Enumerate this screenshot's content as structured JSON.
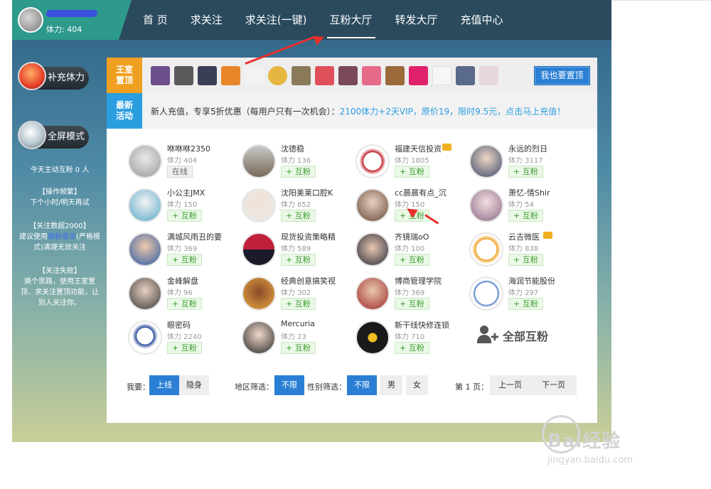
{
  "profile": {
    "stamina_text": "体力: 404"
  },
  "nav": {
    "items": [
      "首 页",
      "求关注",
      "求关注(一键)",
      "互粉大厅",
      "转发大厅",
      "充值中心"
    ],
    "active": "互粉大厅"
  },
  "sidebar": {
    "refill_label": "补充体力",
    "fullscreen_label": "全屏模式",
    "today_text": "今天主动互粉 0 人",
    "ops_title": "【操作频繁】",
    "ops_text": "下个小时/明天再试",
    "follow_title": "【关注数超2000】",
    "follow_text_1": "建议使用",
    "follow_link": "猫粉查杀",
    "follow_text_2": "(严格模式)清理无效关注",
    "fail_title": "【关注失败】",
    "fail_text": "换个思路，使用王室置顶、求关注置顶功能，让别人关注你。"
  },
  "king_row": {
    "tag_1": "王室",
    "tag_2": "置顶",
    "pin_button": "我也要置顶"
  },
  "activity_row": {
    "tag_1": "最新",
    "tag_2": "活动",
    "text": "新人充值，专享5折优惠（每用户只有一次机会）：",
    "link": "2100体力+2天VIP，原价19，限时9.5元，点击马上充值！"
  },
  "users": [
    {
      "name": "咻咻咻2350",
      "stamina": "体力 404",
      "button": "在线"
    },
    {
      "name": "沈德稳",
      "stamina": "体力 136",
      "button": "+ 互粉"
    },
    {
      "name": "福建天信投资",
      "stamina": "体力 1805",
      "button": "+ 互粉"
    },
    {
      "name": "永远的烈日",
      "stamina": "体力 3117",
      "button": "+ 互粉"
    },
    {
      "name": "小公主JMX",
      "stamina": "体力 150",
      "button": "+ 互粉"
    },
    {
      "name": "沈阳美莱口腔K",
      "stamina": "体力 652",
      "button": "+ 互粉"
    },
    {
      "name": "cc晨晨有点_沉",
      "stamina": "体力 150",
      "button": "+ 互粉"
    },
    {
      "name": "萧忆-情Shir",
      "stamina": "体力 54",
      "button": "+ 互粉"
    },
    {
      "name": "满城风雨丑的要",
      "stamina": "体力 369",
      "button": "+ 互粉"
    },
    {
      "name": "现货投资策略精",
      "stamina": "体力 589",
      "button": "+ 互粉"
    },
    {
      "name": "齐镜瑞oO",
      "stamina": "体力 100",
      "button": "+ 互粉"
    },
    {
      "name": "云吉微医",
      "stamina": "体力 838",
      "button": "+ 互粉"
    },
    {
      "name": "金峰解盘",
      "stamina": "体力 96",
      "button": "+ 互粉"
    },
    {
      "name": "经典创意搞笑视",
      "stamina": "体力 302",
      "button": "+ 互粉"
    },
    {
      "name": "博商管理学院",
      "stamina": "体力 369",
      "button": "+ 互粉"
    },
    {
      "name": "海润节能股份",
      "stamina": "体力 297",
      "button": "+ 互粉"
    },
    {
      "name": "眼密码",
      "stamina": "体力 2240",
      "button": "+ 互粉"
    },
    {
      "name": "Mercuria",
      "stamina": "体力 23",
      "button": "+ 互粉"
    },
    {
      "name": "新干线快修连锁",
      "stamina": "体力 710",
      "button": "+ 互粉"
    }
  ],
  "all_fans_label": "全部互粉",
  "filters": {
    "want_label": "我要：",
    "online": "上线",
    "hidden": "隐身",
    "region_label": "地区筛选：",
    "region_all": "不限",
    "gender_label": "性别筛选：",
    "gender_all": "不限",
    "male": "男",
    "female": "女",
    "page_info": "第 1 页：",
    "prev": "上一页",
    "next": "下一页"
  },
  "watermark": {
    "brand": "Bai经验",
    "url": "jingyan.baidu.com"
  },
  "colors": {
    "accent_blue": "#2a7fd4",
    "king_orange": "#f0a020",
    "activity_blue": "#2a9ee0",
    "fan_green": "#3a9b2e",
    "annotation_red": "#e8302a"
  },
  "icons": {
    "refill": "potion-icon",
    "fullscreen": "magnifier-icon",
    "all_fans": "add-user-icon",
    "crown": "crown-icon"
  }
}
